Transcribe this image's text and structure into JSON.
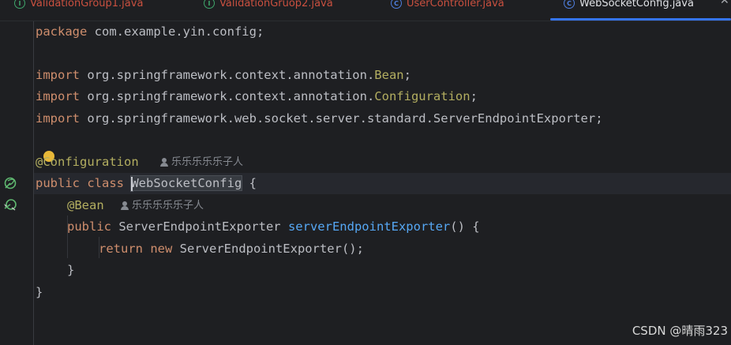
{
  "tabs": [
    {
      "label": "ValidationGroup1.java",
      "kind": "interface",
      "icon": "interface-icon"
    },
    {
      "label": "ValidationGruop2.java",
      "kind": "interface",
      "icon": "interface-icon"
    },
    {
      "label": "UserController.java",
      "kind": "class",
      "icon": "class-icon"
    },
    {
      "label": "WebSocketConfig.java",
      "kind": "class",
      "icon": "class-icon",
      "active": true
    }
  ],
  "code": {
    "l1_pkg_kw": "package",
    "l1_pkg": " com.example.yin.config;",
    "l3_imp_kw": "import",
    "l3_path": " org.springframework.context.annotation.",
    "l3_cls": "Bean",
    "l3_end": ";",
    "l4_imp_kw": "import",
    "l4_path": " org.springframework.context.annotation.",
    "l4_cls": "Configuration",
    "l4_end": ";",
    "l5_imp_kw": "import",
    "l5_path": " org.springframework.web.socket.server.standard.ServerEndpointExporter;",
    "l7_ann": "@Configuration",
    "l8_kw": "public class ",
    "l8_name": "WebSocketConfig",
    "l8_end": " {",
    "l9_ann": "@Bean",
    "l10_kw": "public",
    "l10_type": " ServerEndpointExporter ",
    "l10_fn": "serverEndpointExporter",
    "l10_end": "() {",
    "l11_kw1": "return",
    "l11_kw2": " new",
    "l11_rest": " ServerEndpointExporter();",
    "l12": "}",
    "l13": "}"
  },
  "hints": {
    "author1": "乐乐乐乐乐子人",
    "author2": "乐乐乐乐乐子人"
  },
  "watermark": "CSDN @晴雨323",
  "colors": {
    "background": "#1e1f22",
    "keyword": "#cf8e6d",
    "annotation": "#b3ae60",
    "function": "#56a8f5",
    "text": "#bcbec4",
    "tab_accent": "#3574f0"
  }
}
